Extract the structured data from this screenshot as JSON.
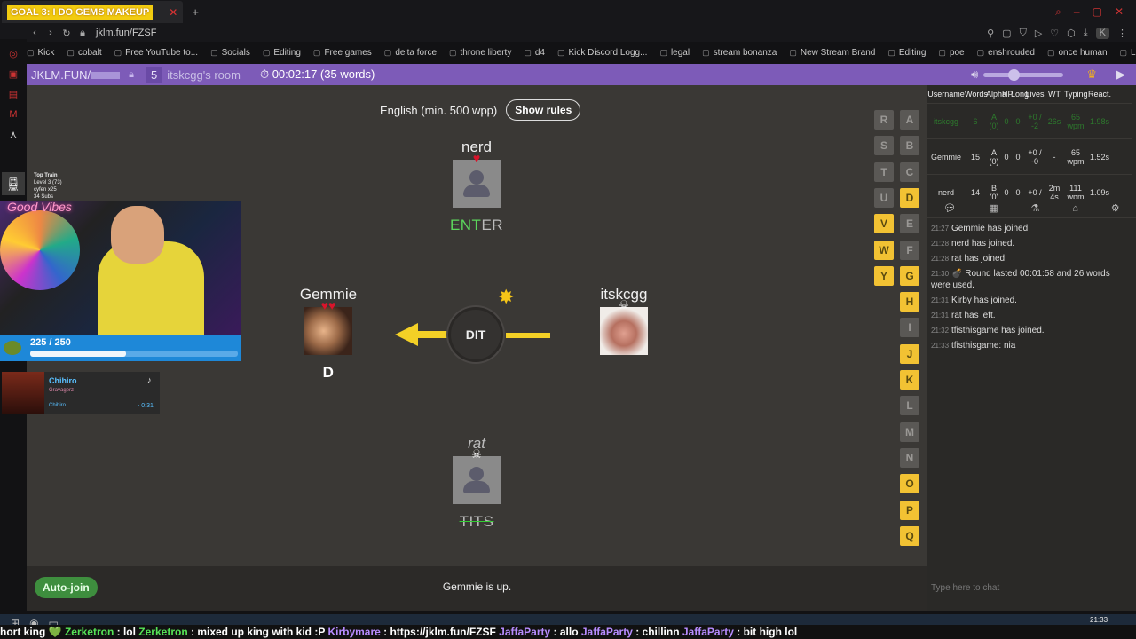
{
  "browser": {
    "tab_title": "GOAL 3: I DO GEMS MAKEUP",
    "url": "jklm.fun/FZSF",
    "bookmarks": [
      "Kick",
      "cobalt",
      "Free YouTube to...",
      "Socials",
      "Editing",
      "Free games",
      "delta force",
      "throne liberty",
      "d4",
      "Kick Discord Logg...",
      "legal",
      "stream bonanza",
      "New Stream Brand",
      "Editing",
      "poe",
      "enshrouded",
      "once human",
      "Last Epoch Patch..."
    ],
    "profile_initial": "K"
  },
  "app": {
    "site": "JKLM.FUN/",
    "room_count": "5",
    "room_name": "itskcgg's room",
    "timer": "00:02:17 (35 words)"
  },
  "game": {
    "rules_text": "English (min. 500 wpp)",
    "rules_button": "Show rules",
    "bomb_syllable": "DIT",
    "players": [
      {
        "name": "nerd",
        "word": "ENTER",
        "word_highlight": "ENT",
        "word_rest": "ER",
        "lives": "♥"
      },
      {
        "name": "Gemmie",
        "word": "D",
        "lives": "♥♥"
      },
      {
        "name": "itskcgg",
        "word": "",
        "lives": "☠"
      },
      {
        "name": "rat",
        "word": "TITS",
        "lives": "☠"
      }
    ],
    "letters_col1": [
      "R",
      "S",
      "T",
      "U",
      "V",
      "W",
      "Y"
    ],
    "letters_col2": [
      "A",
      "B",
      "C",
      "D",
      "E",
      "F",
      "G",
      "H",
      "I",
      "J",
      "K",
      "L",
      "M",
      "N",
      "O",
      "P",
      "Q"
    ],
    "used_letters": [
      "D",
      "V",
      "W",
      "Y",
      "G",
      "H",
      "J",
      "K",
      "O",
      "P",
      "Q"
    ]
  },
  "footer": {
    "autojoin": "Auto-join",
    "status": "Gemmie is up."
  },
  "scoreboard": {
    "headers": [
      "Username",
      "Words",
      "Alpha",
      "HP",
      "Long",
      "Lives",
      "WT",
      "Typing",
      "React."
    ],
    "rows": [
      {
        "user": "itskcgg",
        "words": "6",
        "alpha": "A (0)",
        "hp": "0",
        "long": "0",
        "lives": "+0 / -2",
        "wt": "26s",
        "typing": "65 wpm",
        "react": "1.98s"
      },
      {
        "user": "Gemmie",
        "words": "15",
        "alpha": "A (0)",
        "hp": "0",
        "long": "0",
        "lives": "+0 / -0",
        "wt": "-",
        "typing": "65 wpm",
        "react": "1.52s"
      },
      {
        "user": "nerd",
        "words": "14",
        "alpha": "B (0)",
        "hp": "0",
        "long": "0",
        "lives": "+0 /",
        "wt": "2m 4s",
        "typing": "111 wpm",
        "react": "1.09s"
      }
    ]
  },
  "chat": {
    "messages": [
      {
        "time": "21:27",
        "text": "Gemmie has joined."
      },
      {
        "time": "21:28",
        "text": "nerd has joined."
      },
      {
        "time": "21:28",
        "text": "rat has joined."
      },
      {
        "time": "21:30",
        "text": "💣 Round lasted 00:01:58 and 26 words were used."
      },
      {
        "time": "21:31",
        "text": "Kirby has joined."
      },
      {
        "time": "21:31",
        "text": "rat has left."
      },
      {
        "time": "21:32",
        "text": "tfisthisgame has joined."
      },
      {
        "time": "21:33",
        "text": "tfisthisgame: nia"
      }
    ],
    "placeholder": "Type here to chat"
  },
  "overlay": {
    "train_title": "Top Train",
    "train_level": "Level 3 (73)",
    "train_user": "cyfen x25",
    "train_subs": "34 Subs",
    "neon_text": "Good Vibes",
    "xp_text": "225 / 250",
    "xp_fraction": 0.46,
    "song_title": "Chihiro",
    "song_artist": "Gravagerz",
    "song_track": "Chihiro",
    "song_time": "- 0:31"
  },
  "taskbar": {
    "time": "21:33"
  },
  "ticker": {
    "segments": [
      {
        "text": "hort king 💚 ",
        "cls": ""
      },
      {
        "text": "Zerketron",
        "cls": "g"
      },
      {
        "text": " : lol  ",
        "cls": ""
      },
      {
        "text": "Zerketron",
        "cls": "g"
      },
      {
        "text": " : mixed up king with kid :P  ",
        "cls": ""
      },
      {
        "text": "Kirbymare",
        "cls": "p"
      },
      {
        "text": " : https://jklm.fun/FZSF  ",
        "cls": ""
      },
      {
        "text": "JaffaParty",
        "cls": "p"
      },
      {
        "text": " : allo  ",
        "cls": ""
      },
      {
        "text": "JaffaParty",
        "cls": "p"
      },
      {
        "text": " : chillinn  ",
        "cls": ""
      },
      {
        "text": "JaffaParty",
        "cls": "p"
      },
      {
        "text": " : bit high lol",
        "cls": ""
      }
    ]
  }
}
